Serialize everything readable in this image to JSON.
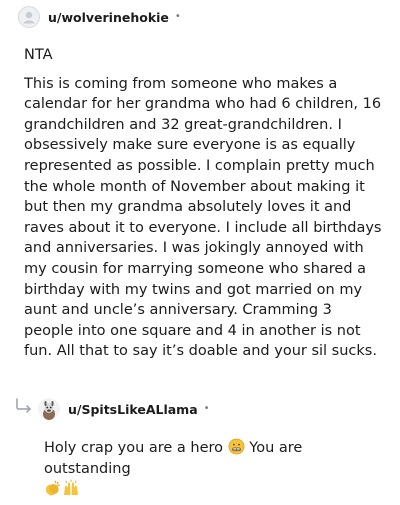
{
  "comment": {
    "username": "u/wolverinehokie",
    "separator": "•",
    "avatar_icon": "default-avatar-icon",
    "paragraphs": [
      "NTA",
      "This is coming from someone who makes a calendar for her grandma who had 6 children, 16 grandchildren and 32 great-grandchildren. I obsessively make sure everyone is as equally represented as possible. I complain pretty much the whole month of November about making it but then my grandma absolutely loves it and raves about it to everyone. I include all birthdays and anniversaries. I was jokingly annoyed with my cousin for marrying someone who shared a birthday with my twins and got married on my aunt and uncle’s anniversary. Cramming 3 people into one square and 4 in another is not fun. All that to say it’s doable and your sil sucks."
    ]
  },
  "reply": {
    "arrow_icon": "reply-arrow-icon",
    "username": "u/SpitsLikeALlama",
    "separator": "•",
    "avatar_icon": "llama-avatar-icon",
    "text_before_emoji": "Holy crap you are a hero ",
    "text_after_emoji": " You are outstanding",
    "emojis": [
      "grimacing-face-icon",
      "clapping-hands-icon",
      "raising-hands-icon"
    ]
  },
  "colors": {
    "text": "#1c1c1c",
    "meta": "#7c7c7c",
    "emoji_yellow": "#f6c33c"
  }
}
